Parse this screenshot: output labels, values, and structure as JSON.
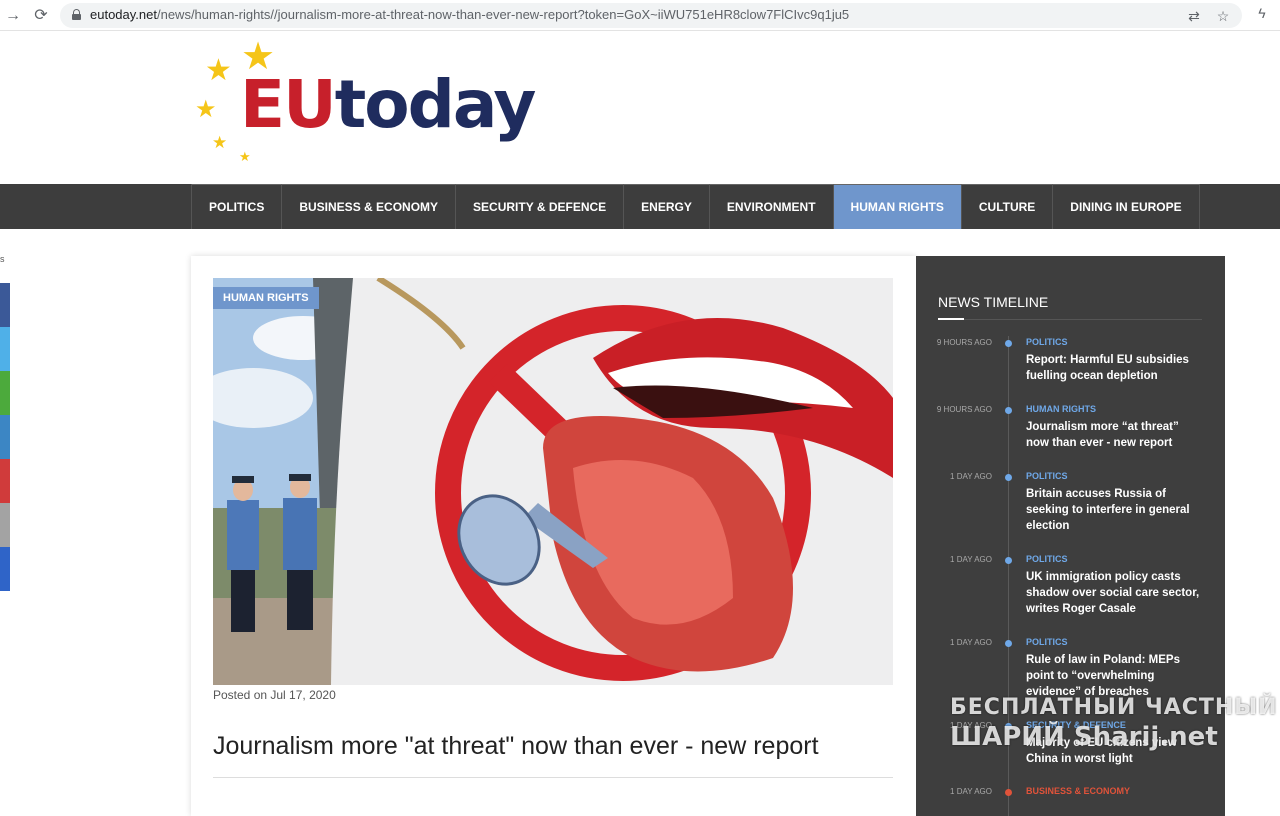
{
  "browser": {
    "url_host": "eutoday.net",
    "url_path": "/news/human-rights//journalism-more-at-threat-now-than-ever-new-report?token=GoX~iiWU751eHR8clow7FlCIvc9q1ju5"
  },
  "logo": {
    "part1": "EU",
    "part2": "today"
  },
  "nav": {
    "items": [
      {
        "label": "POLITICS"
      },
      {
        "label": "BUSINESS & ECONOMY"
      },
      {
        "label": "SECURITY & DEFENCE"
      },
      {
        "label": "ENERGY"
      },
      {
        "label": "ENVIRONMENT"
      },
      {
        "label": "HUMAN RIGHTS",
        "active": true
      },
      {
        "label": "CULTURE"
      },
      {
        "label": "DINING IN EUROPE"
      }
    ]
  },
  "left_strip": {
    "letter": "s"
  },
  "article": {
    "category": "HUMAN RIGHTS",
    "posted": "Posted on Jul 17, 2020",
    "title": "Journalism more \"at threat\" now than ever - new report"
  },
  "timeline": {
    "heading": "NEWS TIMELINE",
    "entries": [
      {
        "time": "9 HOURS AGO",
        "category": "POLITICS",
        "cat_color": "#6fa8e8",
        "title": "Report: Harmful EU subsidies fuelling ocean depletion"
      },
      {
        "time": "9 HOURS AGO",
        "category": "HUMAN RIGHTS",
        "cat_color": "#6fa8e8",
        "title": "Journalism more “at threat” now than ever - new report"
      },
      {
        "time": "1 DAY AGO",
        "category": "POLITICS",
        "cat_color": "#6fa8e8",
        "title": "Britain accuses Russia of seeking to interfere in general election"
      },
      {
        "time": "1 DAY AGO",
        "category": "POLITICS",
        "cat_color": "#6fa8e8",
        "title": "UK immigration policy casts shadow over social care sector, writes Roger Casale"
      },
      {
        "time": "1 DAY AGO",
        "category": "POLITICS",
        "cat_color": "#6fa8e8",
        "title": "Rule of law in Poland: MEPs point to “overwhelming evidence” of breaches"
      },
      {
        "time": "1 DAY AGO",
        "category": "SECURITY & DEFENCE",
        "cat_color": "#6fa8e8",
        "title": "Majority of EU citizens view China in worst light"
      },
      {
        "time": "1 DAY AGO",
        "category": "BUSINESS & ECONOMY",
        "cat_color": "#e0533a",
        "title": ""
      }
    ]
  },
  "watermark": {
    "line1": "БЕСПЛАТНЫЙ ЧАСТНЫЙ",
    "line2": "ШАРИЙ Sharij.net"
  }
}
